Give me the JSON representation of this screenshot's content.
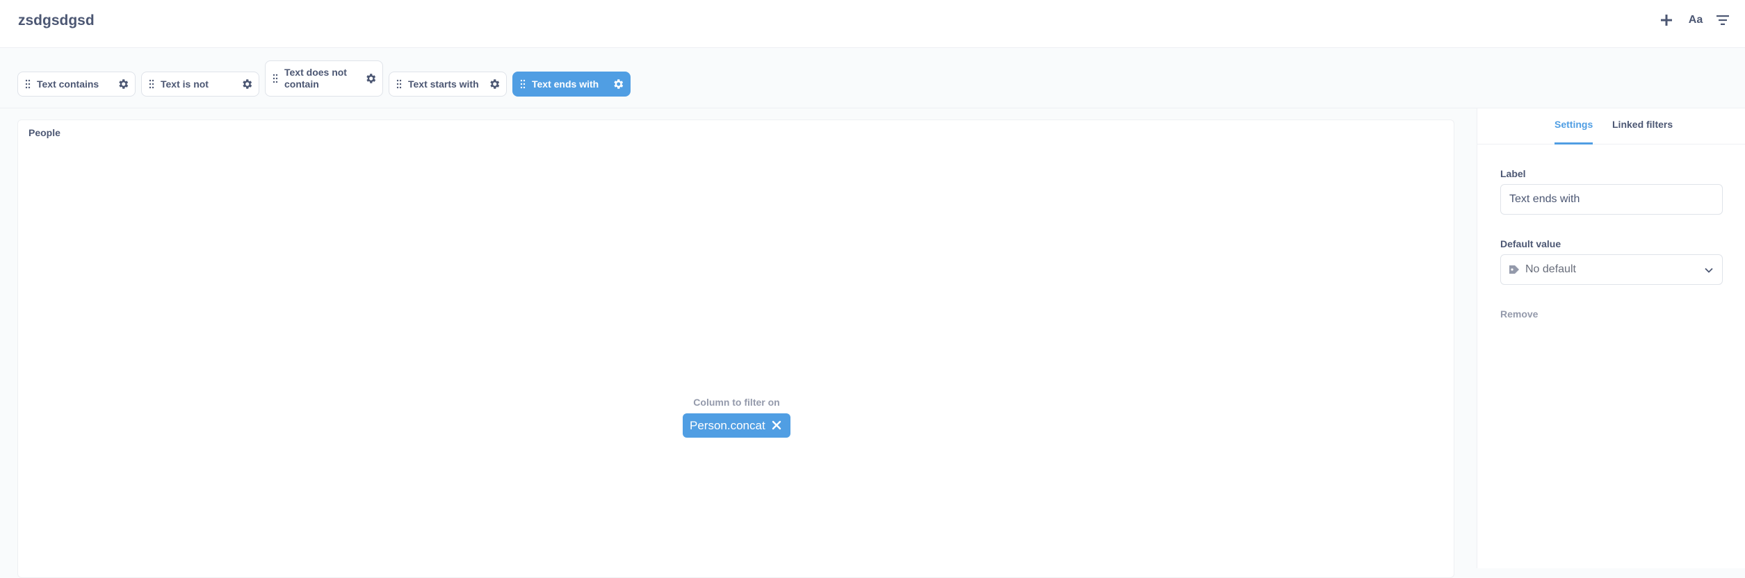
{
  "header": {
    "title": "zsdgsdgsd",
    "icons": {
      "add": "plus-icon",
      "text": "Aa",
      "filter": "filter-icon"
    }
  },
  "filters": [
    {
      "label": "Text contains",
      "active": false
    },
    {
      "label": "Text is not",
      "active": false
    },
    {
      "label": "Text does not contain",
      "active": false
    },
    {
      "label": "Text starts with",
      "active": false
    },
    {
      "label": "Text ends with",
      "active": true
    }
  ],
  "card": {
    "title": "People",
    "column_label": "Column to filter on",
    "column_value": "Person.concat"
  },
  "sidebar": {
    "tabs": [
      {
        "label": "Settings",
        "active": true
      },
      {
        "label": "Linked filters",
        "active": false
      }
    ],
    "label_field": {
      "label": "Label",
      "value": "Text ends with"
    },
    "default_field": {
      "label": "Default value",
      "value": "No default"
    },
    "remove_label": "Remove"
  },
  "colors": {
    "accent": "#509ee3",
    "text": "#4c5773",
    "muted": "#949aab",
    "border": "#dfe3e9"
  }
}
